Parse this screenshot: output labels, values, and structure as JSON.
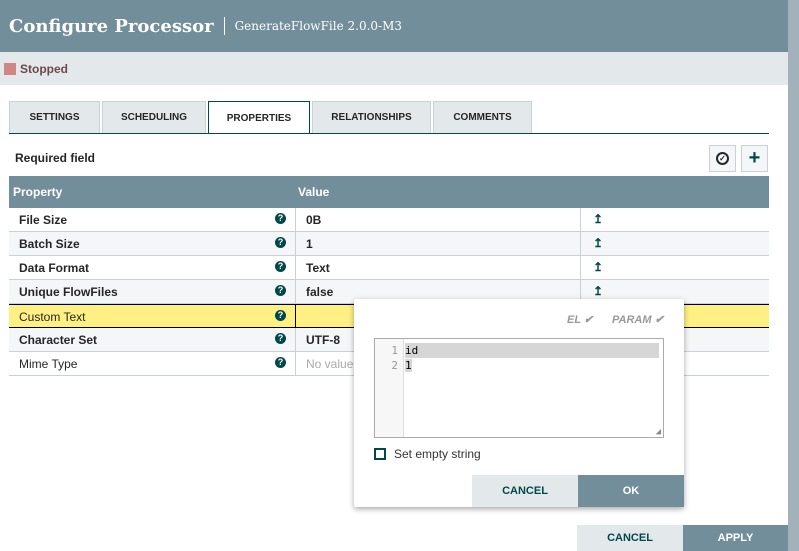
{
  "header": {
    "title": "Configure Processor",
    "subtitle": "GenerateFlowFile 2.0.0-M3"
  },
  "status": {
    "label": "Stopped",
    "color": "#d18686"
  },
  "tabs": [
    "SETTINGS",
    "SCHEDULING",
    "PROPERTIES",
    "RELATIONSHIPS",
    "COMMENTS"
  ],
  "active_tab": "PROPERTIES",
  "required_label": "Required field",
  "table": {
    "headers": [
      "Property",
      "Value"
    ],
    "rows": [
      {
        "name": "File Size",
        "value": "0B"
      },
      {
        "name": "Batch Size",
        "value": "1"
      },
      {
        "name": "Data Format",
        "value": "Text"
      },
      {
        "name": "Unique FlowFiles",
        "value": "false"
      },
      {
        "name": "Custom Text",
        "value": ""
      },
      {
        "name": "Character Set",
        "value": "UTF-8"
      },
      {
        "name": "Mime Type",
        "value": "No value"
      }
    ]
  },
  "editor": {
    "el_label": "EL",
    "param_label": "PARAM",
    "lines": [
      "id",
      "1"
    ],
    "line_numbers": [
      "1",
      "2"
    ],
    "empty_string_label": "Set empty string",
    "cancel": "CANCEL",
    "ok": "OK"
  },
  "footer": {
    "cancel": "CANCEL",
    "apply": "APPLY"
  }
}
